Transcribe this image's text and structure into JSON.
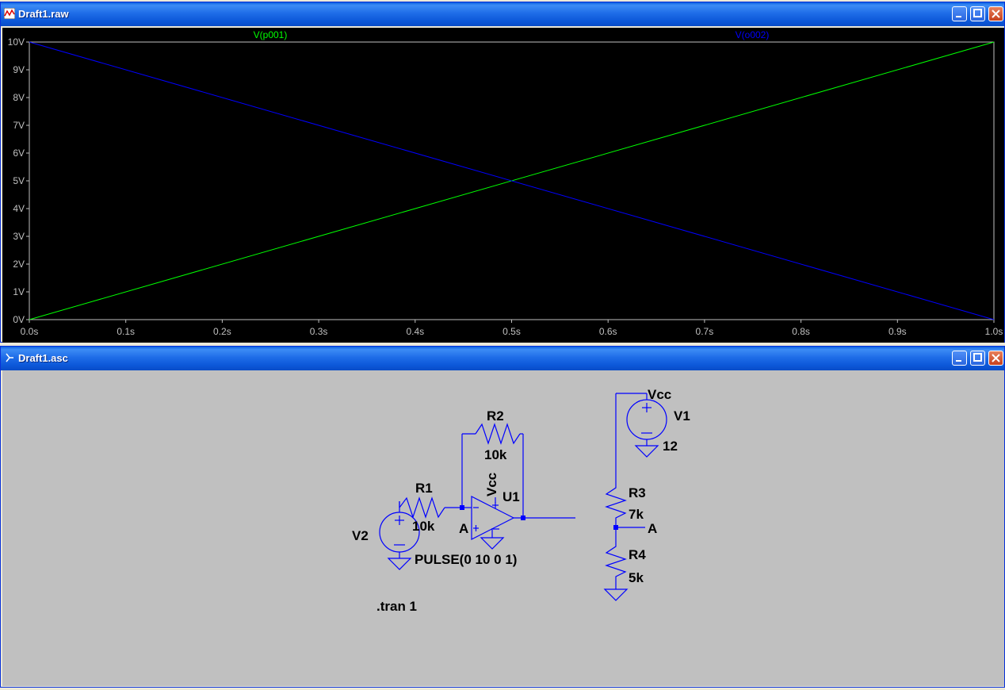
{
  "waveform_window": {
    "title": "Draft1.raw",
    "buttons": {
      "minimize": "minimize",
      "maximize": "maximize",
      "close": "close"
    }
  },
  "schematic_window": {
    "title": "Draft1.asc",
    "buttons": {
      "minimize": "minimize",
      "maximize": "maximize",
      "close": "close"
    },
    "labels": {
      "r1": "R1",
      "r1_value": "10k",
      "r2": "R2",
      "r2_value": "10k",
      "r3": "R3",
      "r3_value": "7k",
      "r4": "R4",
      "r4_value": "5k",
      "v1": "V1",
      "v1_value": "12",
      "v2": "V2",
      "v2_value": "PULSE(0 10 0 1)",
      "u1": "U1",
      "vcc_opamp": "Vcc",
      "vcc_supply": "Vcc",
      "net_a_input": "A",
      "net_a_divider": "A",
      "directive": ".tran 1"
    }
  },
  "chart_data": {
    "type": "line",
    "title": "",
    "xlabel": "",
    "ylabel": "",
    "xlim": [
      0,
      1
    ],
    "ylim": [
      0,
      10
    ],
    "x_tick_labels": [
      "0.0s",
      "0.1s",
      "0.2s",
      "0.3s",
      "0.4s",
      "0.5s",
      "0.6s",
      "0.7s",
      "0.8s",
      "0.9s",
      "1.0s"
    ],
    "y_tick_labels": [
      "0V",
      "1V",
      "2V",
      "3V",
      "4V",
      "5V",
      "6V",
      "7V",
      "8V",
      "9V",
      "10V"
    ],
    "x": [
      0,
      1
    ],
    "series": [
      {
        "name": "V(p001)",
        "color": "#00ff00",
        "values": [
          0,
          10
        ]
      },
      {
        "name": "V(o002)",
        "color": "#0000ff",
        "values": [
          10,
          0
        ]
      }
    ],
    "grid": false,
    "legend": "top"
  }
}
